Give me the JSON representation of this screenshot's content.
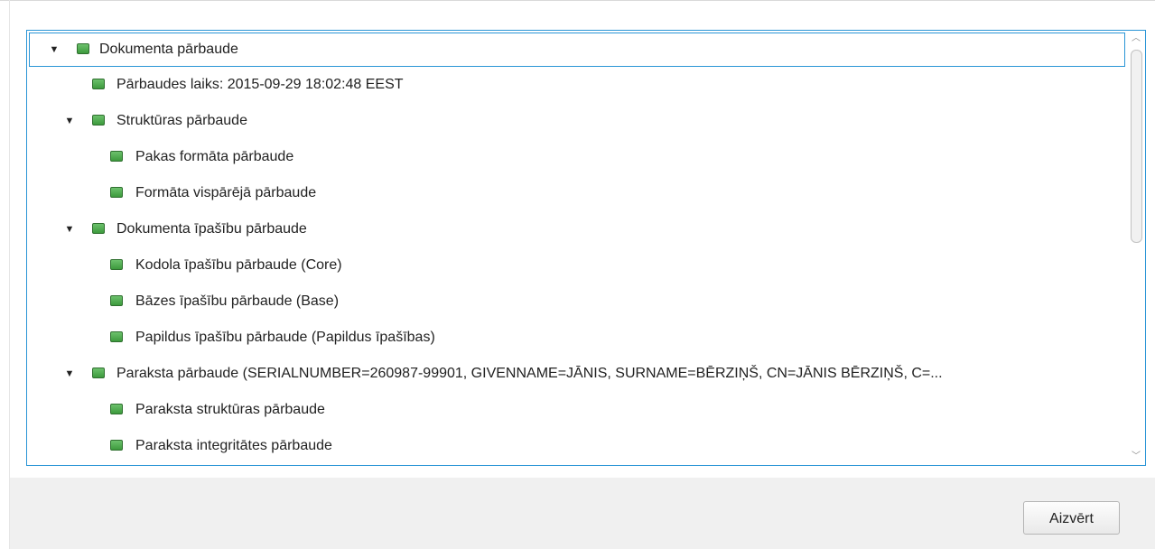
{
  "tree": {
    "nodes": [
      {
        "label": "Dokumenta pārbaude",
        "expanded": true,
        "status": "ok"
      },
      {
        "label": "Pārbaudes laiks: 2015-09-29 18:02:48 EEST",
        "status": "ok"
      },
      {
        "label": "Struktūras pārbaude",
        "expanded": true,
        "status": "ok"
      },
      {
        "label": "Pakas formāta pārbaude",
        "status": "ok"
      },
      {
        "label": "Formāta vispārējā pārbaude",
        "status": "ok"
      },
      {
        "label": "Dokumenta īpašību pārbaude",
        "expanded": true,
        "status": "ok"
      },
      {
        "label": "Kodola īpašību pārbaude (Core)",
        "status": "ok"
      },
      {
        "label": "Bāzes īpašību pārbaude (Base)",
        "status": "ok"
      },
      {
        "label": "Papildus īpašību pārbaude (Papildus īpašības)",
        "status": "ok"
      },
      {
        "label": "Paraksta pārbaude (SERIALNUMBER=260987-99901, GIVENNAME=JĀNIS, SURNAME=BĒRZIŅŠ, CN=JĀNIS BĒRZIŅŠ, C=...",
        "expanded": true,
        "status": "ok"
      },
      {
        "label": "Paraksta struktūras pārbaude",
        "status": "ok"
      },
      {
        "label": "Paraksta integritātes pārbaude",
        "status": "ok"
      }
    ],
    "expand_glyph": "▼"
  },
  "icons": {
    "status_ok": "green-square-icon",
    "expand": "triangle-down-icon",
    "scroll_up": "chevron-up-icon",
    "scroll_down": "chevron-down-icon"
  },
  "scrollbar": {
    "up_glyph": "︿",
    "down_glyph": "﹀"
  },
  "footer": {
    "close_label": "Aizvērt"
  },
  "colors": {
    "accent": "#2a95d6",
    "status_ok": "#4caf50",
    "footer_bg": "#f0f0f0"
  }
}
